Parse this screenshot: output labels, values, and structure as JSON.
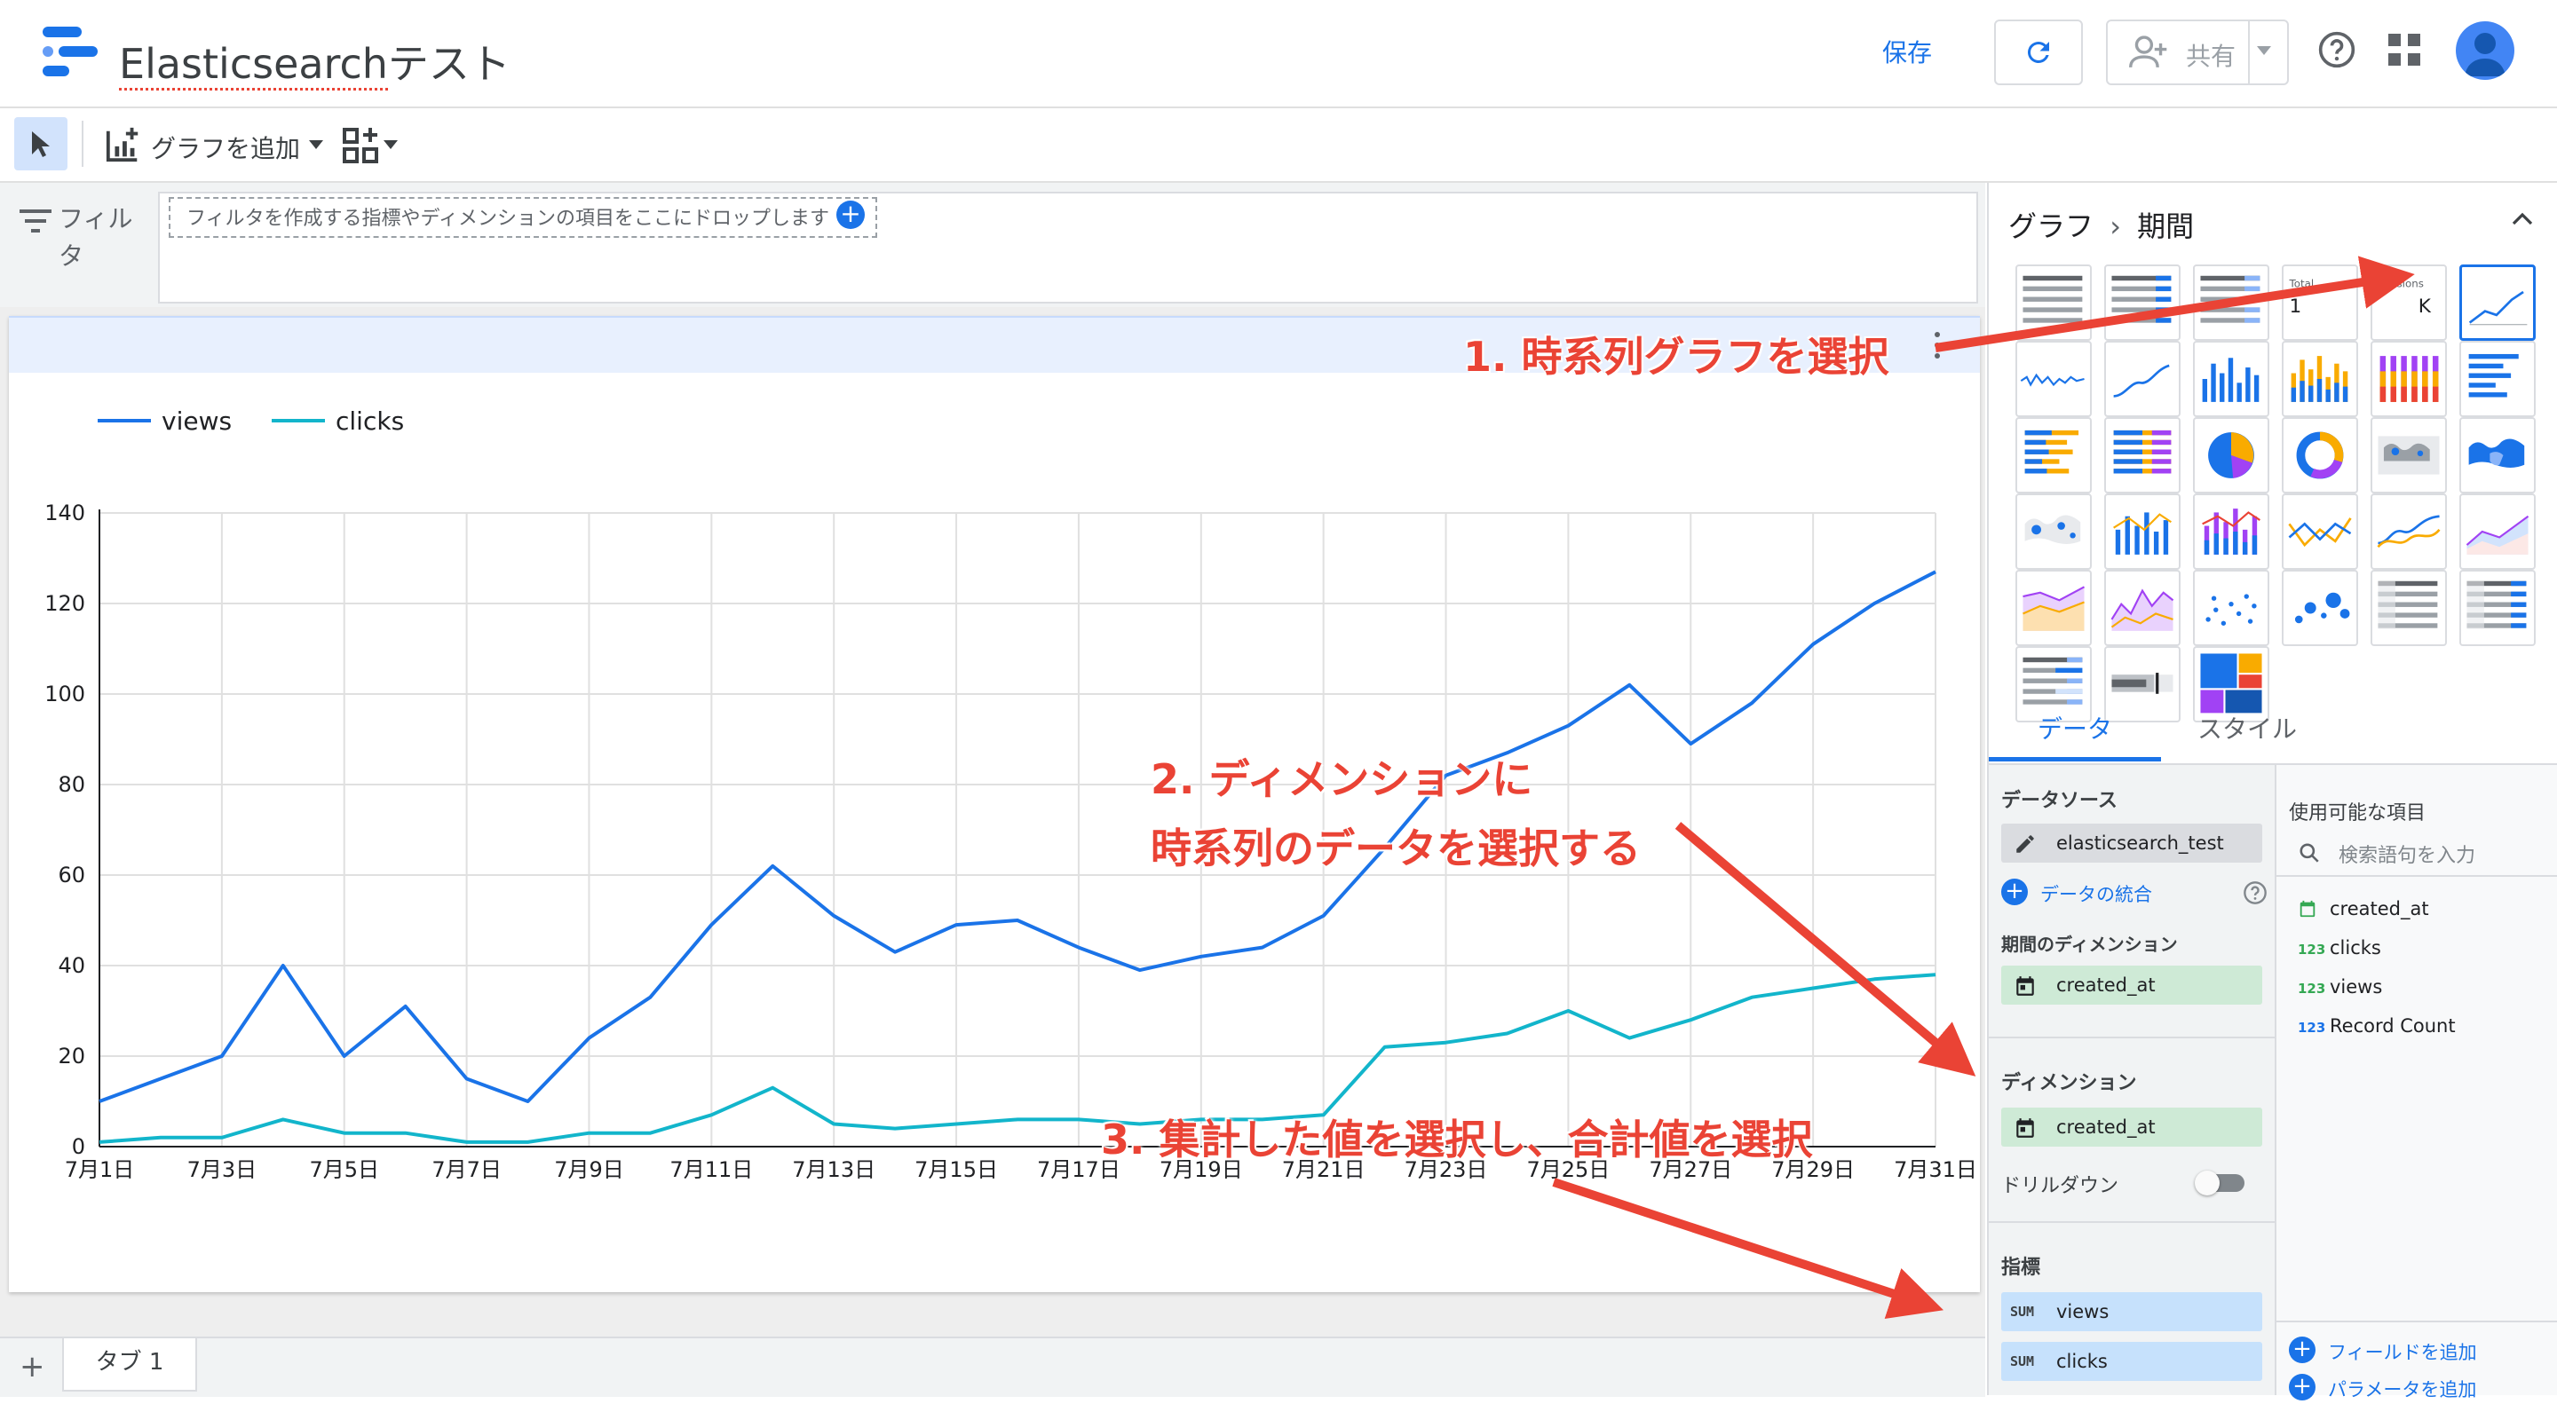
{
  "header": {
    "title_prefix": "Elasticsearch",
    "title_suffix": "テスト",
    "save_label": "保存",
    "share_label": "共有"
  },
  "toolbar": {
    "add_chart_label": "グラフを追加"
  },
  "filter": {
    "label": "フィルタ",
    "drop_placeholder": "フィルタを作成する指標やディメンションの項目をここにドロップします"
  },
  "chart_data": {
    "type": "line",
    "x": [
      "7月1日",
      "7月2日",
      "7月3日",
      "7月4日",
      "7月5日",
      "7月6日",
      "7月7日",
      "7月8日",
      "7月9日",
      "7月10日",
      "7月11日",
      "7月12日",
      "7月13日",
      "7月14日",
      "7月15日",
      "7月16日",
      "7月17日",
      "7月18日",
      "7月19日",
      "7月20日",
      "7月21日",
      "7月22日",
      "7月23日",
      "7月24日",
      "7月25日",
      "7月26日",
      "7月27日",
      "7月28日",
      "7月29日",
      "7月30日",
      "7月31日"
    ],
    "x_tick_labels": [
      "7月1日",
      "7月3日",
      "7月5日",
      "7月7日",
      "7月9日",
      "7月11日",
      "7月13日",
      "7月15日",
      "7月17日",
      "7月19日",
      "7月21日",
      "7月23日",
      "7月25日",
      "7月27日",
      "7月29日",
      "7月31日"
    ],
    "series": [
      {
        "name": "views",
        "color": "#1a73e8",
        "values": [
          10,
          15,
          20,
          40,
          20,
          31,
          15,
          10,
          24,
          33,
          49,
          62,
          51,
          43,
          49,
          50,
          44,
          39,
          42,
          44,
          51,
          66,
          82,
          87,
          93,
          102,
          89,
          98,
          111,
          120,
          127
        ]
      },
      {
        "name": "clicks",
        "color": "#12b5cb",
        "values": [
          1,
          2,
          2,
          6,
          3,
          3,
          1,
          1,
          3,
          3,
          7,
          13,
          5,
          4,
          5,
          6,
          6,
          5,
          6,
          6,
          7,
          22,
          23,
          25,
          30,
          24,
          28,
          33,
          35,
          37,
          38
        ]
      }
    ],
    "ylim": [
      0,
      140
    ],
    "y_ticks": [
      0,
      20,
      40,
      60,
      80,
      100,
      120,
      140
    ],
    "grid": true,
    "legend": "top-left"
  },
  "pages": {
    "add": "+",
    "tab1": "タブ 1"
  },
  "panel": {
    "crumb_parent": "グラフ",
    "crumb_sep": "›",
    "crumb_current": "期間",
    "scorecard_total_label": "Total",
    "scorecard_sessions_label": "Sessions",
    "scorecard_value": "K",
    "tab_data": "データ",
    "tab_style": "スタイル",
    "data_source_label": "データソース",
    "data_source": "elasticsearch_test",
    "blend_label": "データの統合",
    "period_dim_label": "期間のディメンション",
    "period_dim": "created_at",
    "dimension_label": "ディメンション",
    "dimension": "created_at",
    "drilldown_label": "ドリルダウン",
    "metrics_label": "指標",
    "metrics": [
      {
        "agg": "SUM",
        "name": "views"
      },
      {
        "agg": "SUM",
        "name": "clicks"
      }
    ],
    "available_label": "使用可能な項目",
    "search_placeholder": "検索語句を入力",
    "fields": [
      {
        "type": "date",
        "name": "created_at"
      },
      {
        "type": "123",
        "name": "clicks"
      },
      {
        "type": "123",
        "name": "views"
      },
      {
        "type": "123",
        "name": "Record Count"
      }
    ],
    "add_field": "フィールドを追加",
    "add_param": "パラメータを追加"
  },
  "annotations": {
    "step1": "1. 時系列グラフを選択",
    "step2_line1": "2. ディメンションに",
    "step2_line2": "時系列のデータを選択する",
    "step3": "3. 集計した値を選択し、合計値を選択"
  }
}
